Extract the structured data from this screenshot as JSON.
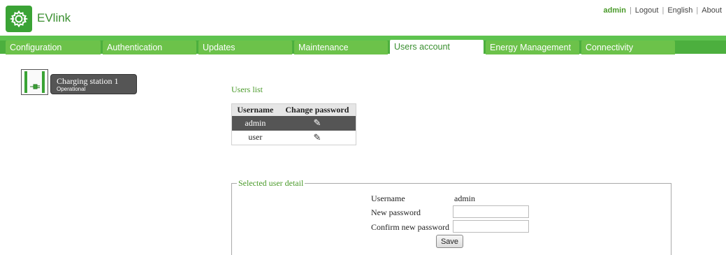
{
  "header": {
    "brand": "EVlink",
    "user": "admin",
    "logout": "Logout",
    "language": "English",
    "about": "About",
    "separator": "|",
    "logo_icon": "gear-icon",
    "brand_color": "#3aa335"
  },
  "tabs": [
    {
      "label": "Configuration",
      "active": false
    },
    {
      "label": "Authentication",
      "active": false
    },
    {
      "label": "Updates",
      "active": false
    },
    {
      "label": "Maintenance",
      "active": false
    },
    {
      "label": "Users account",
      "active": true
    },
    {
      "label": "Energy Management",
      "active": false
    },
    {
      "label": "Connectivity",
      "active": false
    }
  ],
  "station": {
    "name": "Charging station 1",
    "status": "Operational",
    "icon": "charging-station-icon"
  },
  "users_list": {
    "title": "Users list",
    "columns": [
      "Username",
      "Change password"
    ],
    "rows": [
      {
        "username": "admin",
        "action_icon": "pencil-icon",
        "selected": true
      },
      {
        "username": "user",
        "action_icon": "pencil-icon",
        "selected": false
      }
    ]
  },
  "detail": {
    "legend": "Selected user detail",
    "username_label": "Username",
    "username_value": "admin",
    "new_password_label": "New password",
    "new_password_value": "",
    "confirm_password_label": "Confirm new password",
    "confirm_password_value": "",
    "save_label": "Save"
  }
}
